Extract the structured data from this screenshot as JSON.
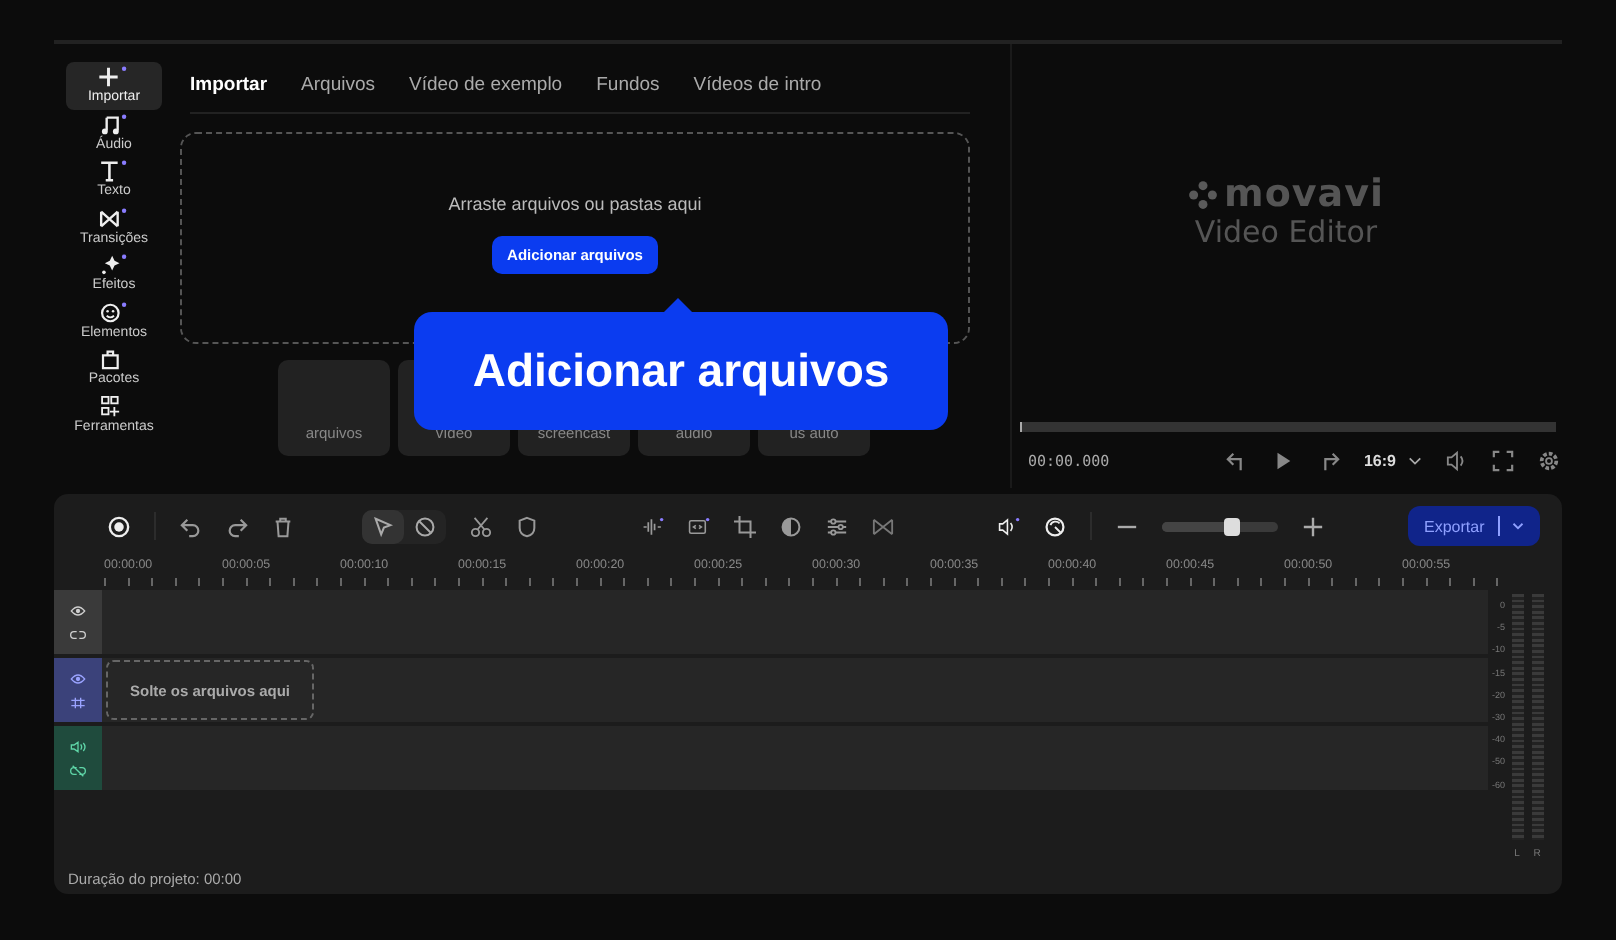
{
  "sidebar": {
    "items": [
      {
        "label": "Importar",
        "selected": true,
        "new": true
      },
      {
        "label": "Áudio",
        "selected": false,
        "new": true
      },
      {
        "label": "Texto",
        "selected": false,
        "new": true
      },
      {
        "label": "Transições",
        "selected": false,
        "new": true
      },
      {
        "label": "Efeitos",
        "selected": false,
        "new": true
      },
      {
        "label": "Elementos",
        "selected": false,
        "new": true
      },
      {
        "label": "Pacotes",
        "selected": false,
        "new": false
      },
      {
        "label": "Ferramentas",
        "selected": false,
        "new": false
      }
    ]
  },
  "tabs": [
    {
      "label": "Importar",
      "selected": true
    },
    {
      "label": "Arquivos",
      "selected": false
    },
    {
      "label": "Vídeo de exemplo",
      "selected": false
    },
    {
      "label": "Fundos",
      "selected": false
    },
    {
      "label": "Vídeos de intro",
      "selected": false
    }
  ],
  "drop_zone": {
    "text": "Arraste arquivos ou pastas aqui",
    "button": "Adicionar arquivos"
  },
  "cards": [
    {
      "label": "arquivos"
    },
    {
      "label": "vídeo"
    },
    {
      "label": "screencast"
    },
    {
      "label": "áudio"
    },
    {
      "label": "us auto"
    }
  ],
  "callout": {
    "text": "Adicionar arquivos"
  },
  "preview": {
    "logo_name": "movavi",
    "logo_product": "Video Editor",
    "progress": {
      "level": 0
    },
    "time": "00:00.000",
    "aspect": "16:9"
  },
  "toolbar": {
    "pointer_tools": [
      {
        "selected": true
      },
      {
        "selected": false
      }
    ],
    "zoom": {
      "level": 0.6
    },
    "export": "Exportar"
  },
  "ruler": [
    "00:00:00",
    "00:00:05",
    "00:00:10",
    "00:00:15",
    "00:00:20",
    "00:00:25",
    "00:00:30",
    "00:00:35",
    "00:00:40",
    "00:00:45",
    "00:00:50",
    "00:00:55"
  ],
  "tracks": [
    {
      "kind": "video"
    },
    {
      "kind": "main",
      "drop_text": "Solte os arquivos aqui"
    },
    {
      "kind": "audio"
    }
  ],
  "meter": {
    "scale": [
      "0",
      "-5",
      "-10",
      "-15",
      "-20",
      "-30",
      "-40",
      "-50",
      "-60"
    ],
    "channels": [
      "L",
      "R"
    ]
  },
  "status": "Duração do projeto: 00:00"
}
